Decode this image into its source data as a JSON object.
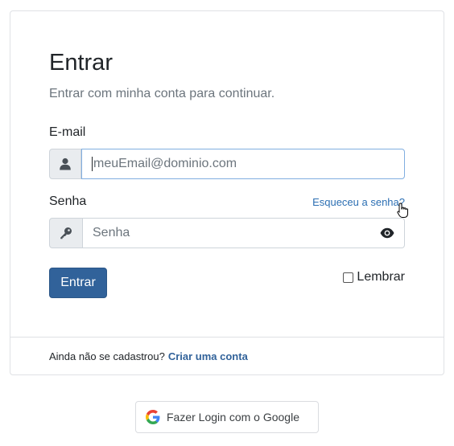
{
  "login": {
    "title": "Entrar",
    "subtitle": "Entrar com minha conta para continuar.",
    "email_label": "E-mail",
    "email_placeholder": "meuEmail@dominio.com",
    "password_label": "Senha",
    "password_placeholder": "Senha",
    "forgot_link": "Esqueceu a senha?",
    "submit_label": "Entrar",
    "remember_label": "Lembrar",
    "remember_checked": false
  },
  "footer": {
    "prompt": "Ainda não se cadastrou?",
    "signup_link": "Criar uma conta"
  },
  "google": {
    "label": "Fazer Login com o Google",
    "icon": "google-g-icon"
  },
  "icons": {
    "email_addon": "user-icon",
    "password_addon": "key-icon",
    "toggle_password": "eye-icon"
  },
  "colors": {
    "primary": "#31629a",
    "link": "#2c6fb3",
    "focus_border": "#80aee0"
  }
}
